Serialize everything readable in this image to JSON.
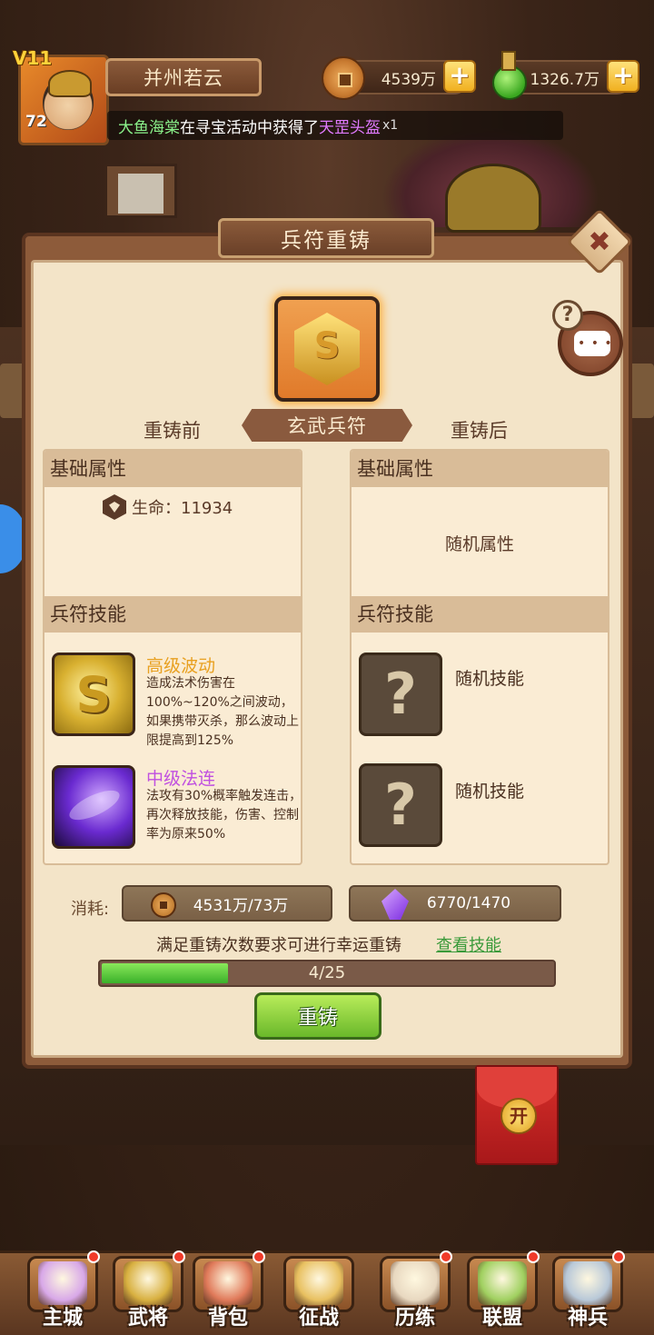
{
  "top_bar": {
    "vip": "V11",
    "level": "72",
    "player_name": "并州若云",
    "coins": "4539万",
    "potion": "1326.7万",
    "plus": "+"
  },
  "marquee": {
    "player": "大鱼海棠",
    "middle": "在寻宝活动中获得了",
    "item": "天罡头盔",
    "qty": "x1"
  },
  "panel": {
    "title": "兵符重铸",
    "close": "✖",
    "help": "?",
    "before_label": "重铸前",
    "after_label": "重铸后",
    "item_name": "玄武兵符"
  },
  "left_column": {
    "base_header": "基础属性",
    "hp_label": "生命：11934",
    "skill_header": "兵符技能",
    "skills": [
      {
        "name": "高级波动",
        "desc": "造成法术伤害在100%~120%之间波动，如果携带灭杀，那么波动上限提高到125%"
      },
      {
        "name": "中级法连",
        "desc": "法攻有30%概率触发连击，再次释放技能，伤害、控制率为原来50%"
      }
    ]
  },
  "right_column": {
    "base_header": "基础属性",
    "random_attr": "随机属性",
    "skill_header": "兵符技能",
    "random_skill_1": "随机技能",
    "random_skill_2": "随机技能"
  },
  "cost": {
    "label": "消耗:",
    "coins": "4531万/73万",
    "gem": "6770/1470"
  },
  "lucky": {
    "text": "满足重铸次数要求可进行幸运重铸",
    "link": "查看技能"
  },
  "progress": {
    "text": "4/25",
    "current": 4,
    "total": 25
  },
  "recast_button": "重铸",
  "red_envelope": "开",
  "bottom_nav": [
    {
      "label": "主城",
      "color": "#d8a8e8",
      "dot": true
    },
    {
      "label": "武将",
      "color": "#d8b040",
      "dot": true
    },
    {
      "label": "背包",
      "color": "#e07a5a",
      "dot": true
    },
    {
      "label": "征战",
      "color": "#e8c060",
      "dot": false
    },
    {
      "label": "历练",
      "color": "#e8d8c0",
      "dot": true
    },
    {
      "label": "联盟",
      "color": "#a0d060",
      "dot": true
    },
    {
      "label": "神兵",
      "color": "#b8c8d8",
      "dot": true
    }
  ]
}
